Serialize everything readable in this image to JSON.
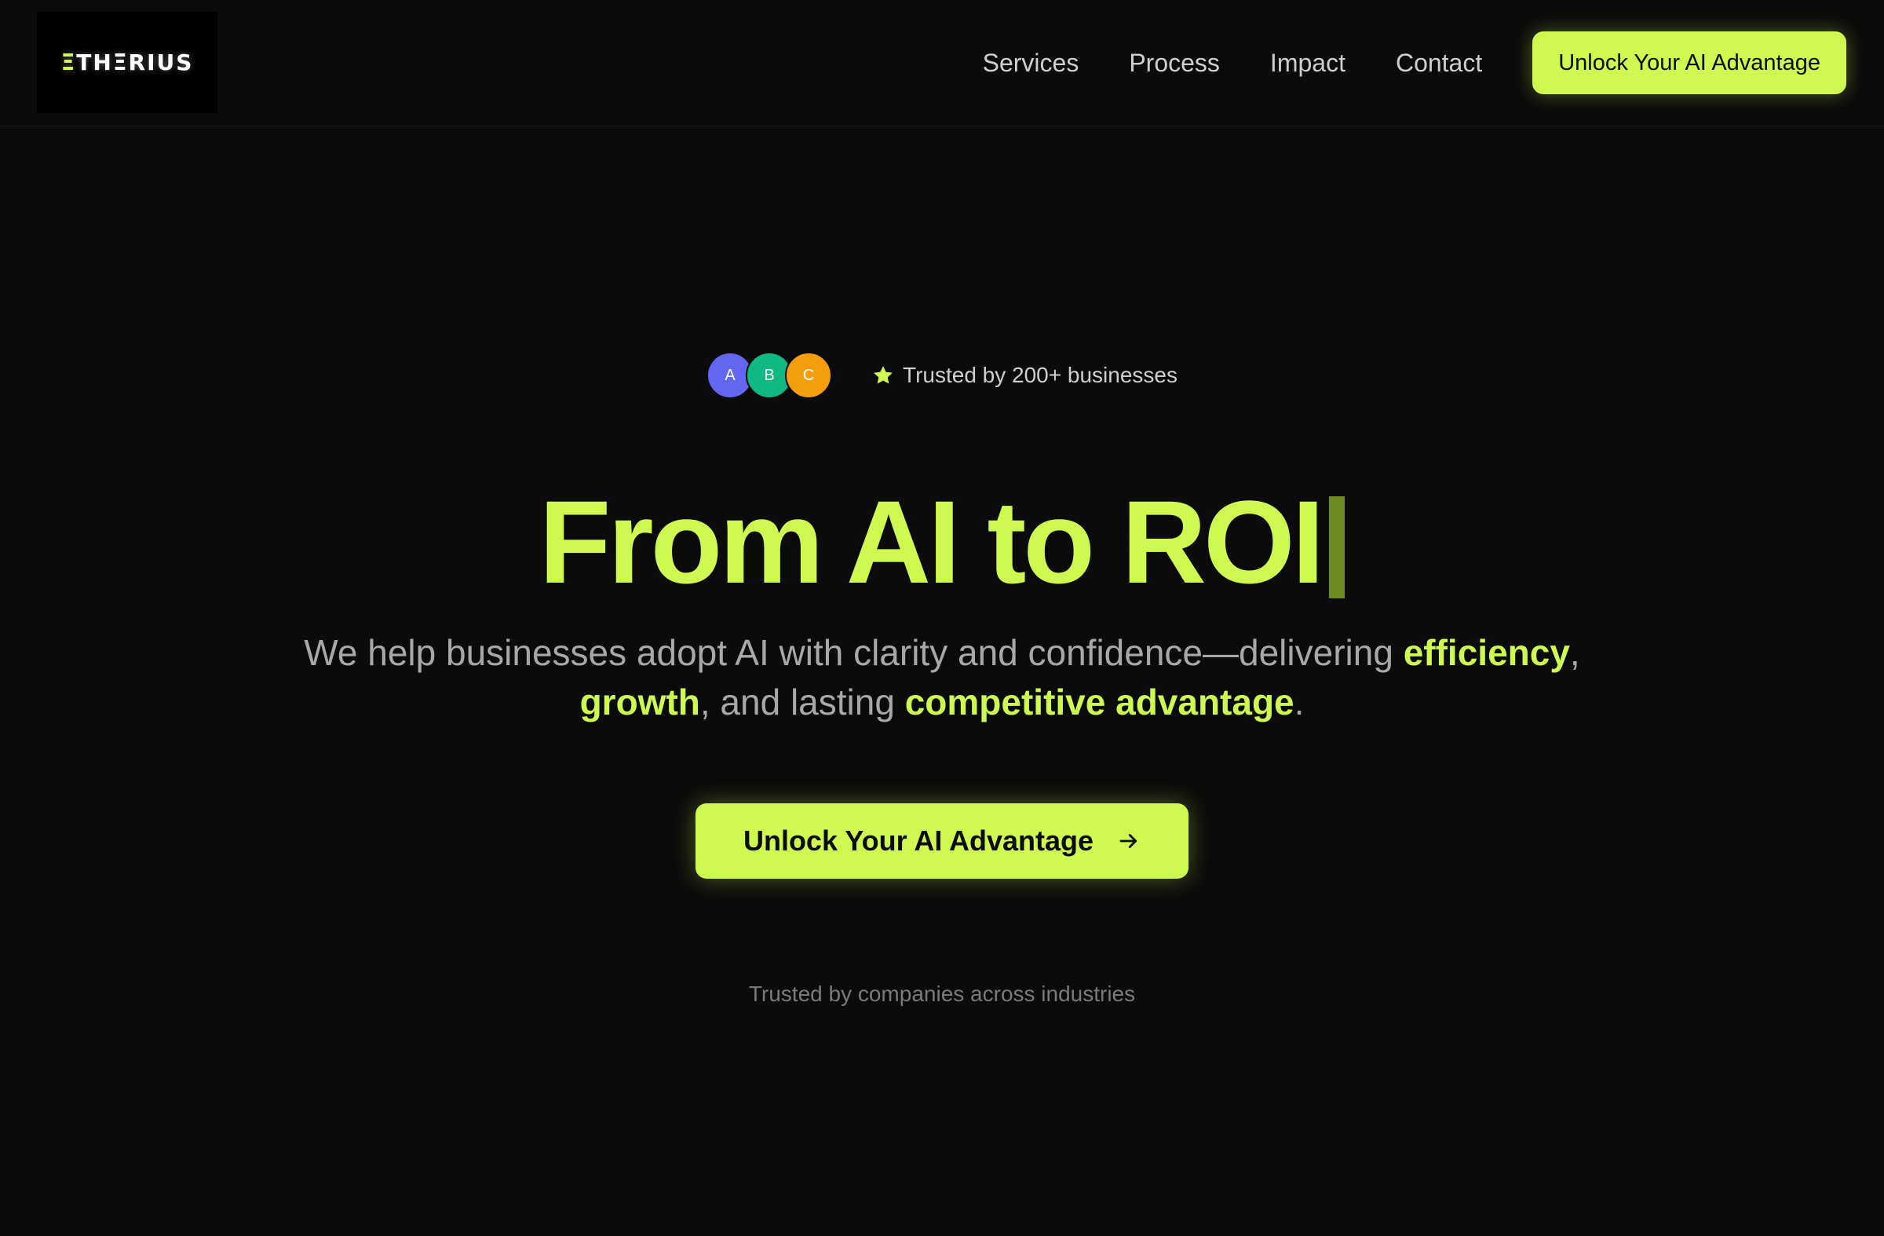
{
  "brand": {
    "logo_prefix": "Ξ",
    "logo_rest": "THΞRIUS"
  },
  "nav": {
    "items": [
      {
        "label": "Services"
      },
      {
        "label": "Process"
      },
      {
        "label": "Impact"
      },
      {
        "label": "Contact"
      }
    ],
    "cta_label": "Unlock Your AI Advantage"
  },
  "trust": {
    "avatars": [
      {
        "letter": "A",
        "color": "#6366f1"
      },
      {
        "letter": "B",
        "color": "#10b981"
      },
      {
        "letter": "C",
        "color": "#f59e0b"
      }
    ],
    "text": "Trusted by 200+ businesses",
    "icon": "star-icon"
  },
  "hero": {
    "headline": "From AI to ROI",
    "sub_part1": "We help businesses adopt AI with clarity and confidence—delivering ",
    "sub_hl1": "efficiency",
    "sub_part2": ",",
    "sub_hl2": "growth",
    "sub_part3": ", and lasting ",
    "sub_hl3": "competitive advantage",
    "sub_part4": ".",
    "cta_label": "Unlock Your AI Advantage",
    "cta_icon": "arrow-right-icon",
    "companies_text": "Trusted by companies across industries"
  },
  "colors": {
    "accent": "#cdf950",
    "background": "#0b0b0b"
  }
}
